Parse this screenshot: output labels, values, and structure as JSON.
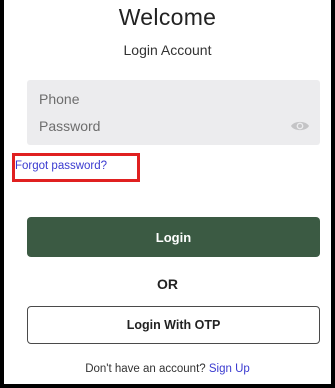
{
  "header": {
    "title": "Welcome",
    "subtitle": "Login Account"
  },
  "form": {
    "phone_placeholder": "Phone",
    "password_placeholder": "Password",
    "password_toggle_icon": "eye-icon",
    "forgot_password": "Forgot password?",
    "login_label": "Login",
    "separator": "OR",
    "otp_label": "Login With OTP"
  },
  "footer": {
    "prompt": "Don't have an account?",
    "signup_label": "Sign Up"
  },
  "colors": {
    "primary_button": "#3b5a43",
    "link": "#3a3ad0",
    "highlight_box": "#e02020",
    "field_background": "#ececee"
  }
}
